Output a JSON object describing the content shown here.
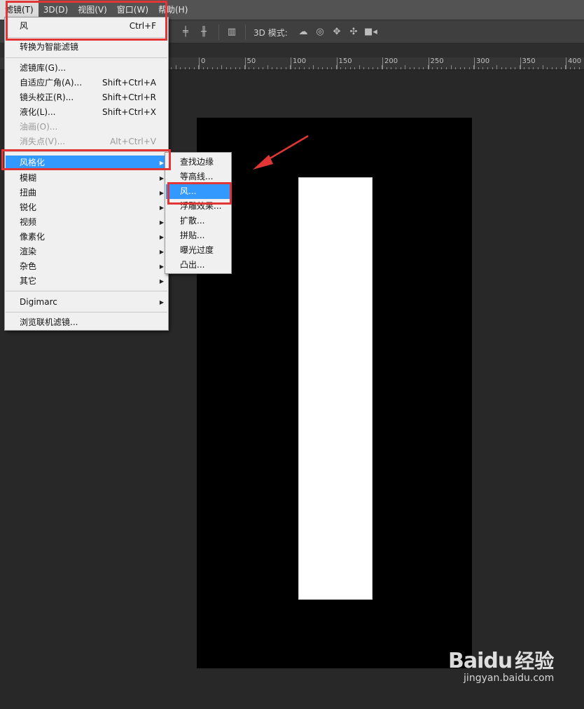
{
  "menubar": {
    "items": [
      "滤镜(T)",
      "3D(D)",
      "视图(V)",
      "窗口(W)",
      "帮助(H)"
    ]
  },
  "options_bar": {
    "mode_label": "3D 模式:",
    "icons": [
      "align-icon",
      "distribute-icon",
      "auto-align-icon",
      "orbit-icon",
      "roll-icon",
      "pan-icon",
      "slide-icon",
      "scale-icon"
    ]
  },
  "ruler": {
    "labels": [
      "0",
      "50",
      "100",
      "150",
      "200",
      "250",
      "300",
      "350",
      "400"
    ]
  },
  "filter_menu": {
    "last_filter": {
      "label": "风",
      "shortcut": "Ctrl+F"
    },
    "convert_smart": "转换为智能滤镜",
    "filter_gallery": "滤镜库(G)...",
    "adaptive_wide": {
      "label": "自适应广角(A)...",
      "shortcut": "Shift+Ctrl+A"
    },
    "lens_correction": {
      "label": "镜头校正(R)...",
      "shortcut": "Shift+Ctrl+R"
    },
    "liquify": {
      "label": "液化(L)...",
      "shortcut": "Shift+Ctrl+X"
    },
    "oil_paint": "油画(O)...",
    "vanishing_point": {
      "label": "消失点(V)...",
      "shortcut": "Alt+Ctrl+V"
    },
    "stylize": "风格化",
    "blur": "模糊",
    "distort": "扭曲",
    "sharpen": "锐化",
    "video": "视频",
    "pixelate": "像素化",
    "render": "渲染",
    "noise": "杂色",
    "other": "其它",
    "digimarc": "Digimarc",
    "browse_online": "浏览联机滤镜..."
  },
  "stylize_submenu": {
    "items": [
      "查找边缘",
      "等高线...",
      "风...",
      "浮雕效果...",
      "扩散...",
      "拼贴...",
      "曝光过度",
      "凸出..."
    ],
    "highlighted": "风..."
  },
  "watermark": {
    "logo": "Baidu",
    "brand_cn": "经验",
    "url": "jingyan.baidu.com"
  },
  "colors": {
    "menu_highlight": "#3399ff",
    "annotation_red": "#e23636",
    "menubar_bg": "#535353",
    "workspace_bg": "#282828"
  }
}
